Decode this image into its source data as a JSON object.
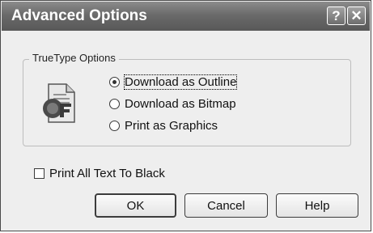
{
  "window": {
    "title": "Advanced Options"
  },
  "titlebar": {
    "help_glyph": "?",
    "close_glyph": "✕"
  },
  "truetype": {
    "group_label": "TrueType Options",
    "icon": "truetype-document-icon",
    "options": [
      {
        "label": "Download as Outline",
        "selected": true
      },
      {
        "label": "Download as Bitmap",
        "selected": false
      },
      {
        "label": "Print as Graphics",
        "selected": false
      }
    ]
  },
  "print_all_black": {
    "label": "Print All Text To Black",
    "checked": false
  },
  "buttons": {
    "ok": "OK",
    "cancel": "Cancel",
    "help": "Help"
  }
}
